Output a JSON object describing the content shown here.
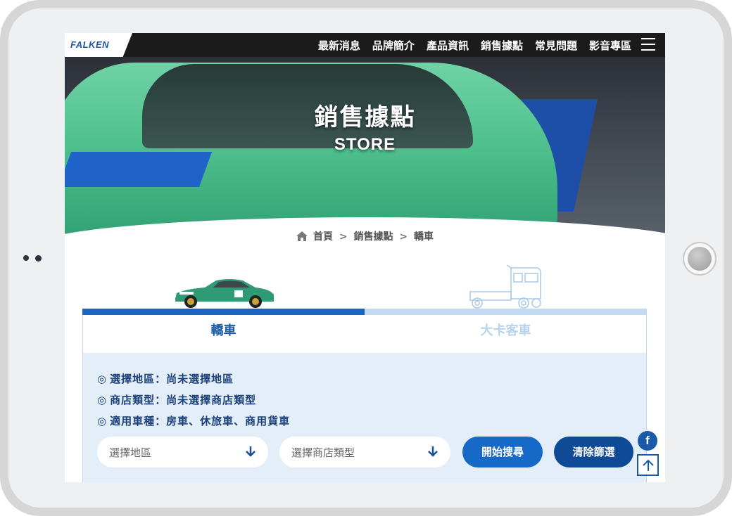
{
  "brand": {
    "logo_text": "FALKEN"
  },
  "nav": {
    "items": [
      {
        "label": "最新消息"
      },
      {
        "label": "品牌簡介"
      },
      {
        "label": "產品資訊"
      },
      {
        "label": "銷售據點"
      },
      {
        "label": "常見問題"
      },
      {
        "label": "影音專區"
      }
    ]
  },
  "hero": {
    "title_zh": "銷售據點",
    "title_en": "STORE"
  },
  "breadcrumb": {
    "home": "首頁",
    "sep1": ">",
    "section": "銷售據點",
    "sep2": ">",
    "current": "轎車"
  },
  "tabs": [
    {
      "label": "轎車",
      "active": true
    },
    {
      "label": "大卡客車",
      "active": false
    }
  ],
  "filters": {
    "mark": "◎",
    "region": "選擇地區：尚未選擇地區",
    "store_type": "商店類型：尚未選擇商店類型",
    "vehicle": "適用車種：房車、休旅車、商用貨車"
  },
  "controls": {
    "region_placeholder": "選擇地區",
    "store_type_placeholder": "選擇商店類型",
    "search_label": "開始搜尋",
    "clear_label": "清除篩選"
  },
  "floating": {
    "facebook": "f"
  },
  "colors": {
    "brand_blue": "#1a64c4",
    "dark_blue": "#0f4a97",
    "panel_bg": "#e3eef8",
    "topbar": "#1b1b1b"
  }
}
